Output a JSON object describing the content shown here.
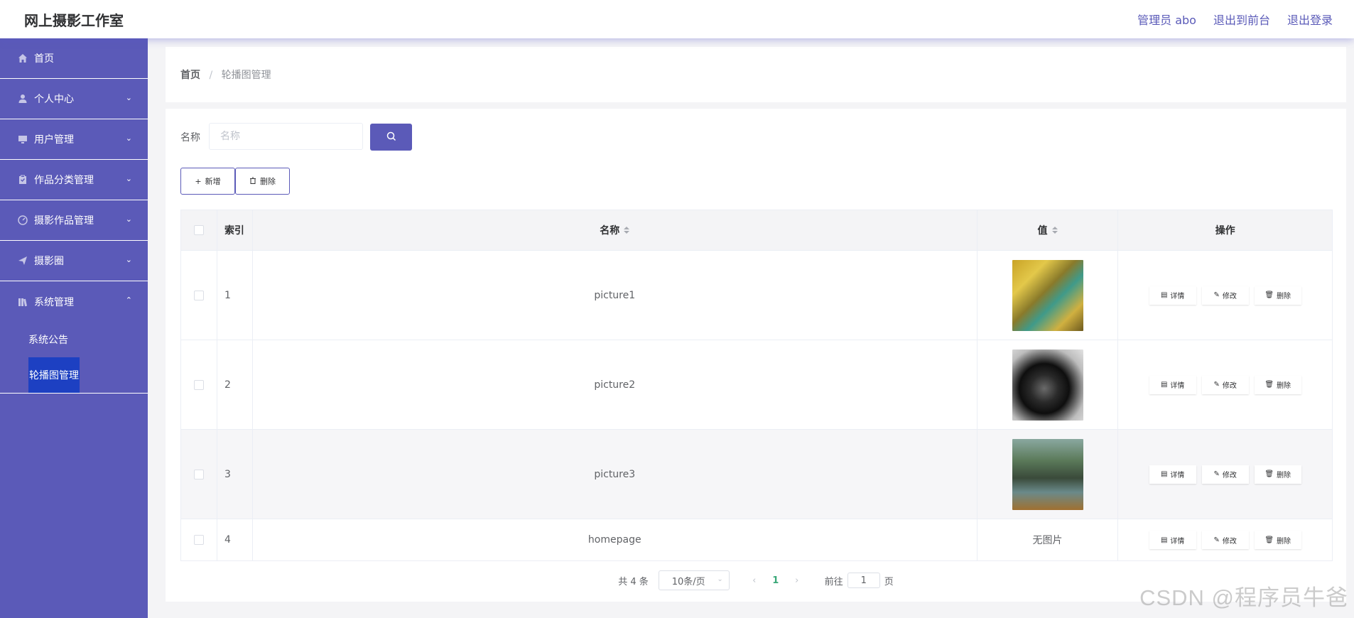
{
  "header": {
    "title": "网上摄影工作室",
    "admin_label": "管理员 abo",
    "back_to_front": "退出到前台",
    "logout": "退出登录"
  },
  "sidebar": {
    "items": [
      {
        "label": "首页",
        "icon": "home-icon"
      },
      {
        "label": "个人中心",
        "icon": "user-icon"
      },
      {
        "label": "用户管理",
        "icon": "monitor-icon"
      },
      {
        "label": "作品分类管理",
        "icon": "clipboard-icon"
      },
      {
        "label": "摄影作品管理",
        "icon": "gauge-icon"
      },
      {
        "label": "摄影圈",
        "icon": "send-icon"
      },
      {
        "label": "系统管理",
        "icon": "library-icon"
      }
    ],
    "sub_items": [
      "系统公告",
      "轮播图管理"
    ]
  },
  "breadcrumb": {
    "home": "首页",
    "separator": "/",
    "current": "轮播图管理"
  },
  "search": {
    "label": "名称",
    "placeholder": "名称",
    "value": ""
  },
  "actions": {
    "add": "新增",
    "delete": "删除"
  },
  "table": {
    "columns": {
      "index": "索引",
      "name": "名称",
      "value": "值",
      "ops": "操作"
    },
    "rows": [
      {
        "index": "1",
        "name": "picture1",
        "value": "",
        "has_image": true
      },
      {
        "index": "2",
        "name": "picture2",
        "value": "",
        "has_image": true
      },
      {
        "index": "3",
        "name": "picture3",
        "value": "",
        "has_image": true
      },
      {
        "index": "4",
        "name": "homepage",
        "value": "无图片",
        "has_image": false
      }
    ],
    "op_labels": {
      "detail": "详情",
      "edit": "修改",
      "delete": "删除"
    }
  },
  "pagination": {
    "total": "共 4 条",
    "page_size": "10条/页",
    "current_page": "1",
    "goto_label": "前往",
    "goto_value": "1",
    "page_suffix": "页"
  },
  "watermark": "CSDN @程序员牛爸",
  "colors": {
    "primary": "#5b5ab8",
    "sidebar_bg": "#5b5ab8",
    "active_sub_bg": "#1d40c2"
  }
}
